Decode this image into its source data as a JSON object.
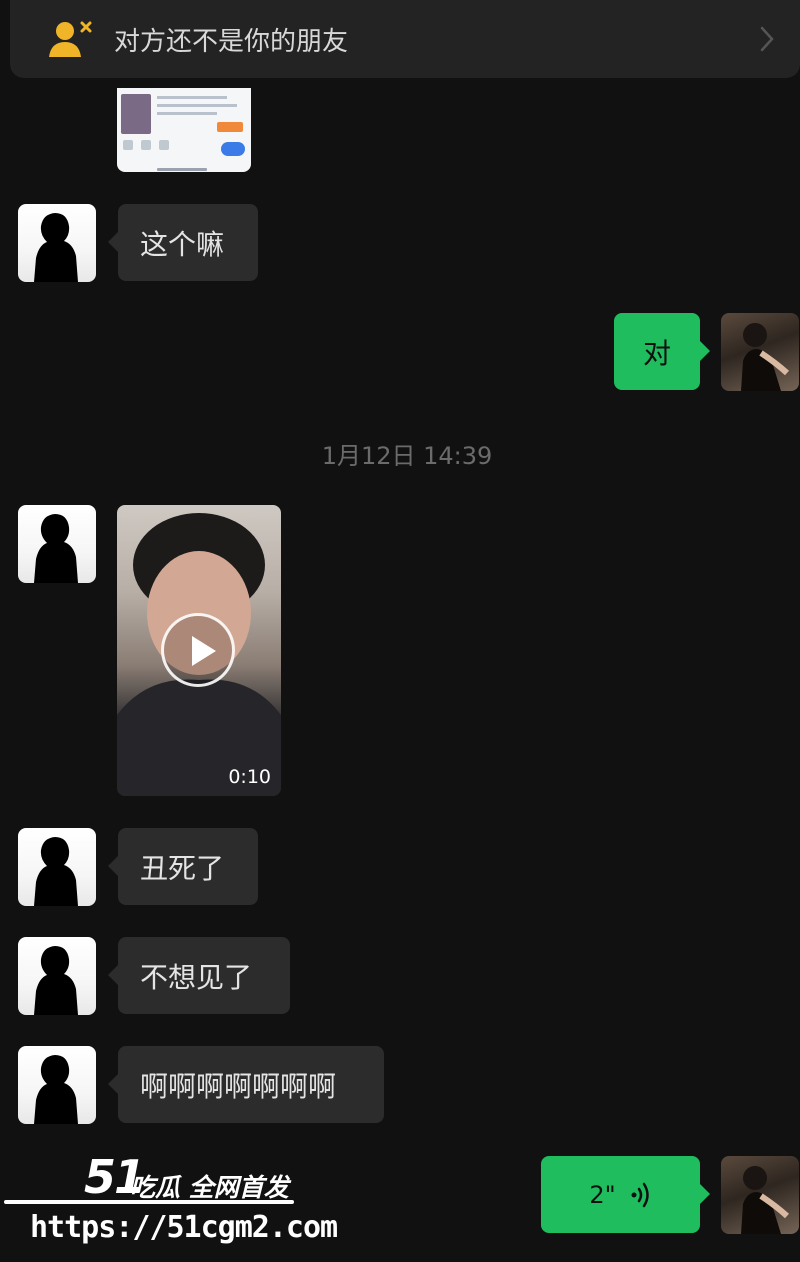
{
  "banner": {
    "text": "对方还不是你的朋友"
  },
  "messages": [
    {
      "side": "left",
      "type": "text",
      "text": "这个嘛"
    },
    {
      "side": "right",
      "type": "text",
      "text": "对"
    },
    {
      "side": "left",
      "type": "video",
      "duration": "0:10"
    },
    {
      "side": "left",
      "type": "text",
      "text": "丑死了"
    },
    {
      "side": "left",
      "type": "text",
      "text": "不想见了"
    },
    {
      "side": "left",
      "type": "text",
      "text": "啊啊啊啊啊啊啊"
    },
    {
      "side": "right",
      "type": "voice",
      "duration": "2\""
    }
  ],
  "timestamp": "1月12日 14:39",
  "watermark": {
    "logo": "51",
    "tag": "吃瓜 全网首发",
    "url": "https://51cgm2.com"
  },
  "colors": {
    "background": "#111111",
    "bubble_in": "#2c2c2c",
    "bubble_out": "#1fbd5e",
    "banner_icon": "#f0b429"
  }
}
